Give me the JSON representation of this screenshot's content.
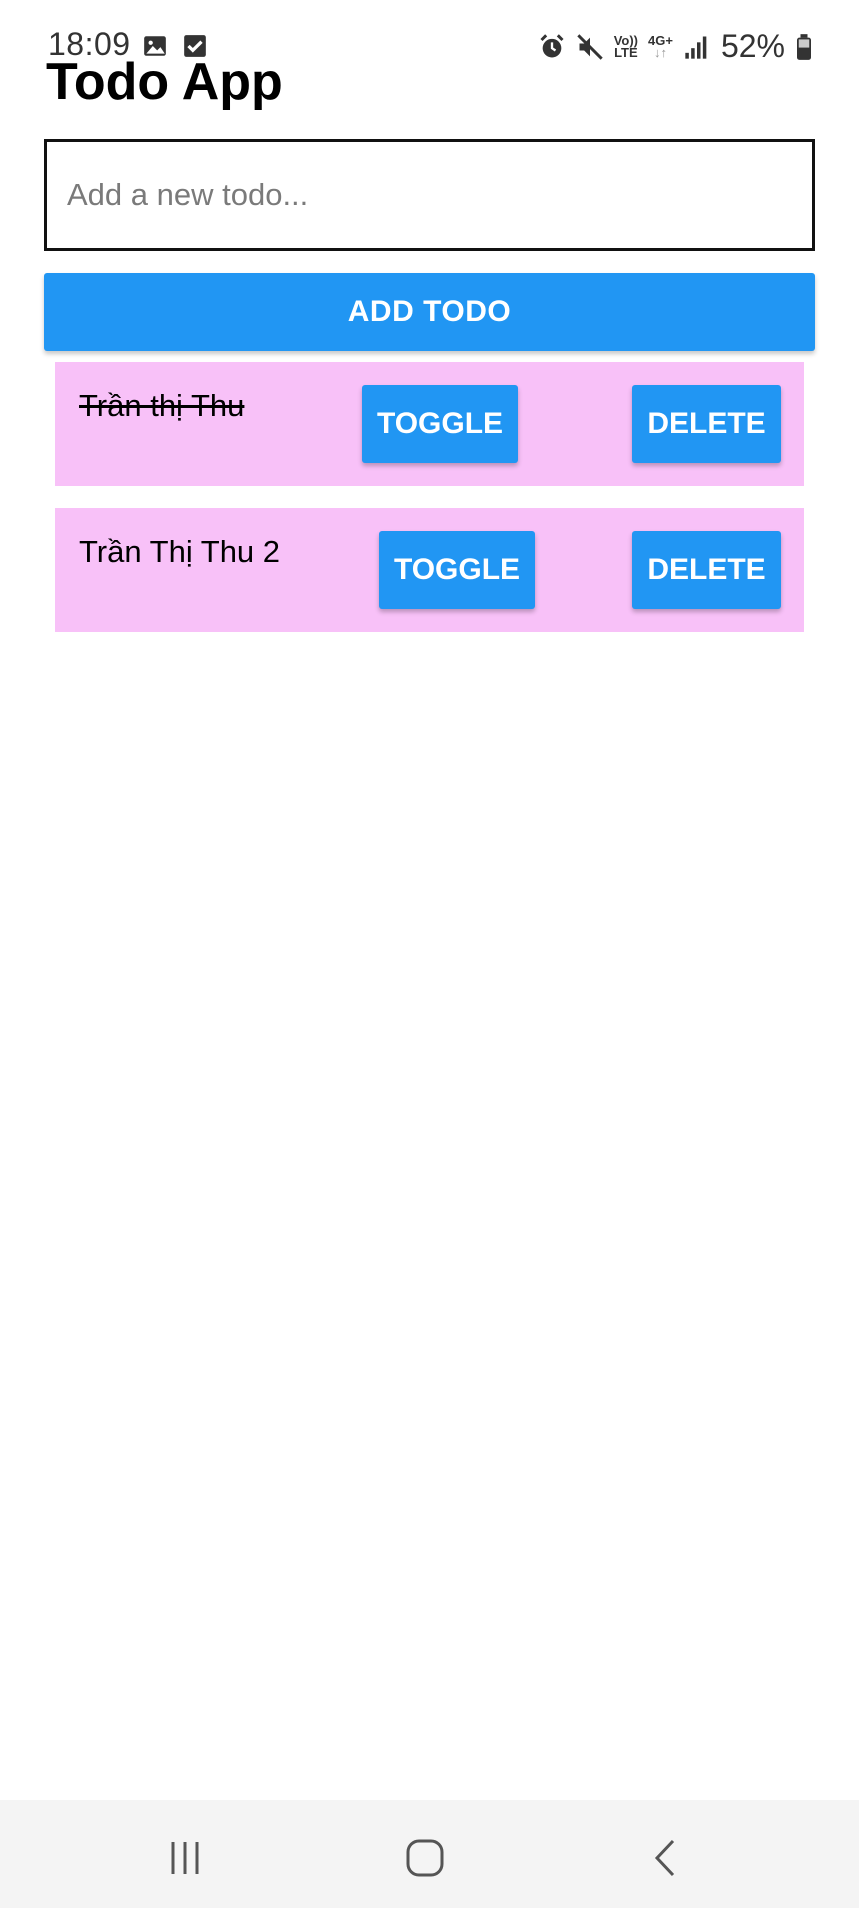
{
  "status_bar": {
    "time": "18:09",
    "left_icons": [
      "image-icon",
      "checkbox-icon"
    ],
    "right_icons": [
      "alarm-icon",
      "mute-icon",
      "volte-icon",
      "4g-plus-icon",
      "signal-icon"
    ],
    "volte_top": "Vo))",
    "volte_bottom": "LTE",
    "network_label": "4G+",
    "battery_percent": "52%"
  },
  "app": {
    "title": "Todo App"
  },
  "input": {
    "placeholder": "Add a new todo...",
    "value": ""
  },
  "add_button": {
    "label": "ADD TODO"
  },
  "todos": [
    {
      "text": "Trần thị Thu",
      "completed": true,
      "toggle_label": "TOGGLE",
      "delete_label": "DELETE"
    },
    {
      "text": "Trần Thị Thu 2",
      "completed": false,
      "toggle_label": "TOGGLE",
      "delete_label": "DELETE"
    }
  ],
  "colors": {
    "accent": "#2196f3",
    "item_background": "#f8c1f8",
    "nav_background": "#f4f4f4"
  },
  "nav_bar": {
    "icons": [
      "recent-apps-icon",
      "home-icon",
      "back-icon"
    ]
  }
}
